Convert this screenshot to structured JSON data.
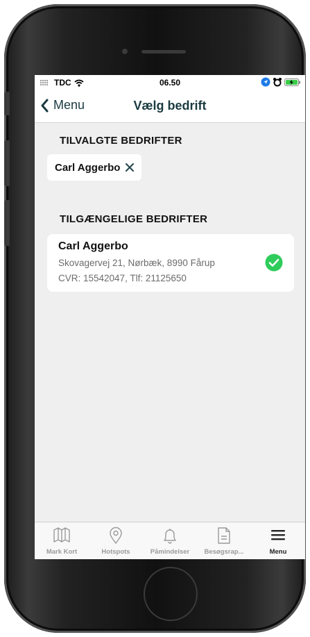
{
  "status_bar": {
    "carrier": "TDC",
    "time": "06.50"
  },
  "nav": {
    "back_label": "Menu",
    "title": "Vælg bedrift"
  },
  "selected_section": {
    "title": "TILVALGTE BEDRIFTER",
    "chips": [
      {
        "label": "Carl Aggerbo"
      }
    ]
  },
  "available_section": {
    "title": "TILGÆNGELIGE BEDRIFTER",
    "items": [
      {
        "name": "Carl Aggerbo",
        "address": "Skovagervej 21, Nørbæk, 8990 Fårup",
        "details": "CVR: 15542047, Tlf: 21125650",
        "selected": true
      }
    ]
  },
  "tabbar": {
    "tabs": [
      {
        "label": "Mark Kort",
        "icon": "map-icon"
      },
      {
        "label": "Hotspots",
        "icon": "location-pin-icon"
      },
      {
        "label": "Påmindelser",
        "icon": "bell-icon"
      },
      {
        "label": "Besøgsrap...",
        "icon": "document-icon"
      },
      {
        "label": "Menu",
        "icon": "hamburger-menu-icon",
        "active": true
      }
    ]
  },
  "colors": {
    "accent_dark": "#1a3a40",
    "check_green": "#2ecc5a",
    "background": "#efefef"
  }
}
